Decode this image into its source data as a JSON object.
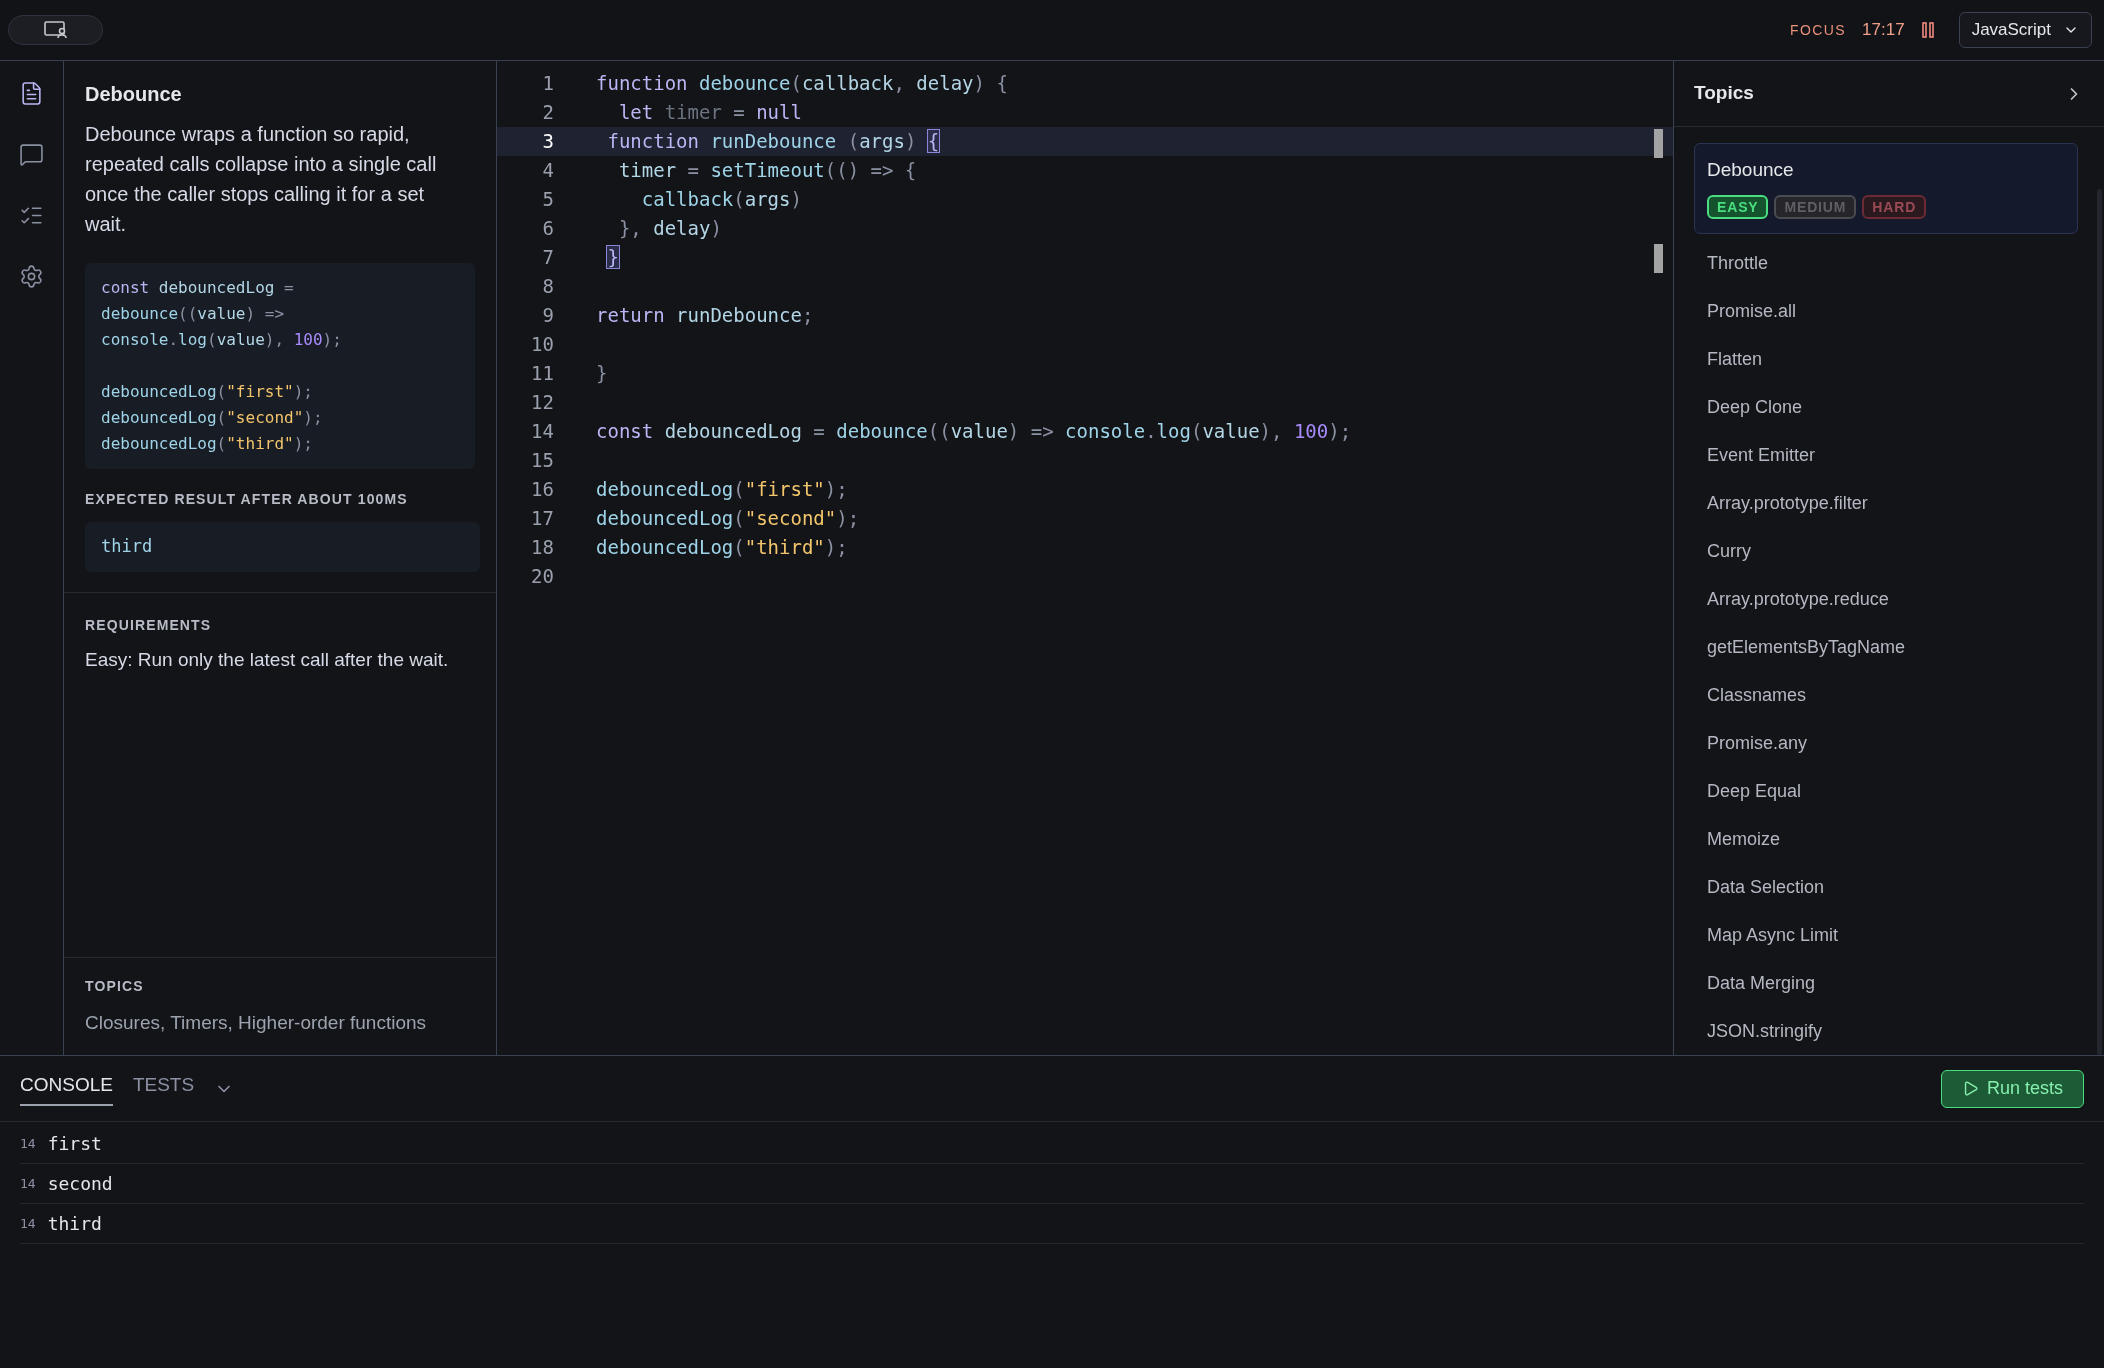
{
  "top_bar": {
    "focus_label": "FOCUS",
    "timer": "17:17",
    "language": "JavaScript"
  },
  "rail": [
    {
      "kind": "file",
      "selected": true
    },
    {
      "kind": "chat",
      "selected": false
    },
    {
      "kind": "checklist",
      "selected": false
    },
    {
      "kind": "settings",
      "selected": false
    }
  ],
  "problem": {
    "title": "Debounce",
    "description": "Debounce wraps a function so rapid, repeated calls collapse into a single call once the caller stops calling it for a set wait.",
    "example": [
      {
        "kind": "code",
        "tokens": [
          {
            "text": "const ",
            "kind": "keyword"
          },
          {
            "text": "debouncedLog ",
            "kind": "ident"
          },
          {
            "text": "=",
            "kind": "punct"
          }
        ]
      },
      {
        "kind": "code",
        "tokens": [
          {
            "text": "debounce",
            "kind": "fn"
          },
          {
            "text": "((",
            "kind": "punct"
          },
          {
            "text": "value",
            "kind": "ident"
          },
          {
            "text": ") =>",
            "kind": "punct"
          }
        ]
      },
      {
        "kind": "code",
        "tokens": [
          {
            "text": "console",
            "kind": "fn"
          },
          {
            "text": ".",
            "kind": "punct"
          },
          {
            "text": "log",
            "kind": "fn"
          },
          {
            "text": "(",
            "kind": "punct"
          },
          {
            "text": "value",
            "kind": "ident"
          },
          {
            "text": "), ",
            "kind": "punct"
          },
          {
            "text": "100",
            "kind": "number"
          },
          {
            "text": ");",
            "kind": "punct"
          }
        ]
      },
      {
        "kind": "blank"
      },
      {
        "kind": "code",
        "tokens": [
          {
            "text": "debouncedLog",
            "kind": "fn"
          },
          {
            "text": "(",
            "kind": "punct"
          },
          {
            "text": "\"first\"",
            "kind": "string"
          },
          {
            "text": ");",
            "kind": "punct"
          }
        ]
      },
      {
        "kind": "code",
        "tokens": [
          {
            "text": "debouncedLog",
            "kind": "fn"
          },
          {
            "text": "(",
            "kind": "punct"
          },
          {
            "text": "\"second\"",
            "kind": "string"
          },
          {
            "text": ");",
            "kind": "punct"
          }
        ]
      },
      {
        "kind": "code",
        "tokens": [
          {
            "text": "debouncedLog",
            "kind": "fn"
          },
          {
            "text": "(",
            "kind": "punct"
          },
          {
            "text": "\"third\"",
            "kind": "string"
          },
          {
            "text": ");",
            "kind": "punct"
          }
        ]
      }
    ],
    "expected_heading": "EXPECTED RESULT AFTER ABOUT 100MS",
    "expected": "third",
    "requirements_heading": "REQUIREMENTS",
    "requirements": "Easy: Run only the latest call after the wait.",
    "topics_heading": "TOPICS",
    "topics": "Closures, Timers, Higher-order functions"
  },
  "editor": {
    "lines": [
      {
        "number": "1",
        "active": false,
        "tokens": [
          {
            "text": "function ",
            "kind": "keyword"
          },
          {
            "text": "debounce",
            "kind": "fn"
          },
          {
            "text": "(",
            "kind": "punct"
          },
          {
            "text": "callback",
            "kind": "ident"
          },
          {
            "text": ", ",
            "kind": "punct"
          },
          {
            "text": "delay",
            "kind": "ident"
          },
          {
            "text": ") {",
            "kind": "punct"
          }
        ]
      },
      {
        "number": "2",
        "active": false,
        "tokens": [
          {
            "text": "  let ",
            "kind": "keyword"
          },
          {
            "text": "timer",
            "kind": "dim"
          },
          {
            "text": " = ",
            "kind": "punct"
          },
          {
            "text": "null",
            "kind": "keyword"
          }
        ]
      },
      {
        "number": "3",
        "active": true,
        "tokens": [
          {
            "text": " function ",
            "kind": "keyword"
          },
          {
            "text": "runDebounce ",
            "kind": "fn"
          },
          {
            "text": "(",
            "kind": "punct"
          },
          {
            "text": "args",
            "kind": "ident"
          },
          {
            "text": ") ",
            "kind": "punct"
          },
          {
            "text": "{",
            "kind": "bracket"
          }
        ]
      },
      {
        "number": "4",
        "active": false,
        "tokens": [
          {
            "text": "  timer",
            "kind": "ident"
          },
          {
            "text": " = ",
            "kind": "punct"
          },
          {
            "text": "setTimeout",
            "kind": "fn"
          },
          {
            "text": "(() => {",
            "kind": "punct"
          }
        ]
      },
      {
        "number": "5",
        "active": false,
        "tokens": [
          {
            "text": "    callback",
            "kind": "fn"
          },
          {
            "text": "(",
            "kind": "punct"
          },
          {
            "text": "args",
            "kind": "ident"
          },
          {
            "text": ")",
            "kind": "punct"
          }
        ]
      },
      {
        "number": "6",
        "active": false,
        "tokens": [
          {
            "text": "  }, ",
            "kind": "punct"
          },
          {
            "text": "delay",
            "kind": "ident"
          },
          {
            "text": ")",
            "kind": "punct"
          }
        ]
      },
      {
        "number": "7",
        "active": false,
        "tokens": [
          {
            "text": " }",
            "kind": "bracket"
          }
        ]
      },
      {
        "number": "8",
        "active": false
      },
      {
        "number": "9",
        "active": false,
        "tokens": [
          {
            "text": "return ",
            "kind": "keyword"
          },
          {
            "text": "runDebounce",
            "kind": "ident"
          },
          {
            "text": ";",
            "kind": "punct"
          }
        ]
      },
      {
        "number": "10",
        "active": false
      },
      {
        "number": "11",
        "active": false,
        "tokens": [
          {
            "text": "}",
            "kind": "punct"
          }
        ]
      },
      {
        "number": "12",
        "active": false
      },
      {
        "number": "14",
        "active": false,
        "tokens": [
          {
            "text": "const ",
            "kind": "keyword"
          },
          {
            "text": "debouncedLog",
            "kind": "ident"
          },
          {
            "text": " = ",
            "kind": "punct"
          },
          {
            "text": "debounce",
            "kind": "fn"
          },
          {
            "text": "((",
            "kind": "punct"
          },
          {
            "text": "value",
            "kind": "ident"
          },
          {
            "text": ") => ",
            "kind": "punct"
          },
          {
            "text": "console",
            "kind": "fn"
          },
          {
            "text": ".",
            "kind": "punct"
          },
          {
            "text": "log",
            "kind": "fn"
          },
          {
            "text": "(",
            "kind": "punct"
          },
          {
            "text": "value",
            "kind": "ident"
          },
          {
            "text": "), ",
            "kind": "punct"
          },
          {
            "text": "100",
            "kind": "number"
          },
          {
            "text": ");",
            "kind": "punct"
          }
        ]
      },
      {
        "number": "15",
        "active": false
      },
      {
        "number": "16",
        "active": false,
        "tokens": [
          {
            "text": "debouncedLog",
            "kind": "fn"
          },
          {
            "text": "(",
            "kind": "punct"
          },
          {
            "text": "\"first\"",
            "kind": "string"
          },
          {
            "text": ");",
            "kind": "punct"
          }
        ]
      },
      {
        "number": "17",
        "active": false,
        "tokens": [
          {
            "text": "debouncedLog",
            "kind": "fn"
          },
          {
            "text": "(",
            "kind": "punct"
          },
          {
            "text": "\"second\"",
            "kind": "string"
          },
          {
            "text": ");",
            "kind": "punct"
          }
        ]
      },
      {
        "number": "18",
        "active": false,
        "tokens": [
          {
            "text": "debouncedLog",
            "kind": "fn"
          },
          {
            "text": "(",
            "kind": "punct"
          },
          {
            "text": "\"third\"",
            "kind": "string"
          },
          {
            "text": ");",
            "kind": "punct"
          }
        ]
      },
      {
        "number": "20",
        "active": false
      }
    ]
  },
  "topics_panel": {
    "title": "Topics",
    "items": [
      {
        "label": "Debounce",
        "selected": true,
        "difficulties": [
          {
            "label": "EASY",
            "kind": "easy",
            "selected": true
          },
          {
            "label": "MEDIUM",
            "kind": "medium",
            "selected": false
          },
          {
            "label": "HARD",
            "kind": "hard",
            "selected": false
          }
        ]
      },
      {
        "label": "Throttle",
        "selected": false
      },
      {
        "label": "Promise.all",
        "selected": false
      },
      {
        "label": "Flatten",
        "selected": false
      },
      {
        "label": "Deep Clone",
        "selected": false
      },
      {
        "label": "Event Emitter",
        "selected": false
      },
      {
        "label": "Array.prototype.filter",
        "selected": false
      },
      {
        "label": "Curry",
        "selected": false
      },
      {
        "label": "Array.prototype.reduce",
        "selected": false
      },
      {
        "label": "getElementsByTagName",
        "selected": false
      },
      {
        "label": "Classnames",
        "selected": false
      },
      {
        "label": "Promise.any",
        "selected": false
      },
      {
        "label": "Deep Equal",
        "selected": false
      },
      {
        "label": "Memoize",
        "selected": false
      },
      {
        "label": "Data Selection",
        "selected": false
      },
      {
        "label": "Map Async Limit",
        "selected": false
      },
      {
        "label": "Data Merging",
        "selected": false
      },
      {
        "label": "JSON.stringify",
        "selected": false
      }
    ]
  },
  "bottom": {
    "tabs": [
      {
        "label": "CONSOLE",
        "selected": true
      },
      {
        "label": "TESTS",
        "selected": false
      }
    ],
    "run_button": "Run tests",
    "console": [
      {
        "line": "14",
        "text": "first"
      },
      {
        "line": "14",
        "text": "second"
      },
      {
        "line": "14",
        "text": "third"
      }
    ]
  }
}
